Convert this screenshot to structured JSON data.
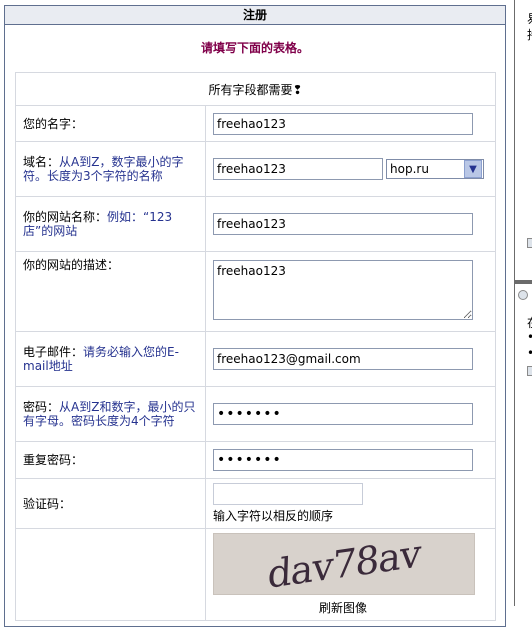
{
  "panel": {
    "title": "注册"
  },
  "intro": "请填写下面的表格。",
  "form": {
    "required_note": "所有字段都需要❢",
    "name": {
      "label": "您的名字：",
      "value": "freehao123"
    },
    "domain": {
      "label": "域名：",
      "hint": "从A到Z，数字最小的字符。长度为3个字符的名称",
      "value": "freehao123",
      "select_value": "hop.ru"
    },
    "site_name": {
      "label": "你的网站名称：",
      "hint": "例如：“123店”的网站",
      "value": "freehao123"
    },
    "description": {
      "label": "你的网站的描述：",
      "value": "freehao123"
    },
    "email": {
      "label": "电子邮件：",
      "hint": "请务必输入您的E-mail地址",
      "value": "freehao123@gmail.com"
    },
    "password": {
      "label": "密码：",
      "hint": "从A到Z和数字，最小的只有字母。密码长度为4个字符",
      "value": "•••••••"
    },
    "repeat_password": {
      "label": "重复密码：",
      "value": "•••••••"
    },
    "captcha": {
      "label": "验证码：",
      "help": "输入字符以相反的顺序",
      "image_text": "dav78av",
      "refresh": "刷新图像"
    }
  },
  "side": {
    "chars": [
      "易",
      "持"
    ],
    "bullets": [
      "•",
      "•"
    ],
    "label_char": "在"
  }
}
